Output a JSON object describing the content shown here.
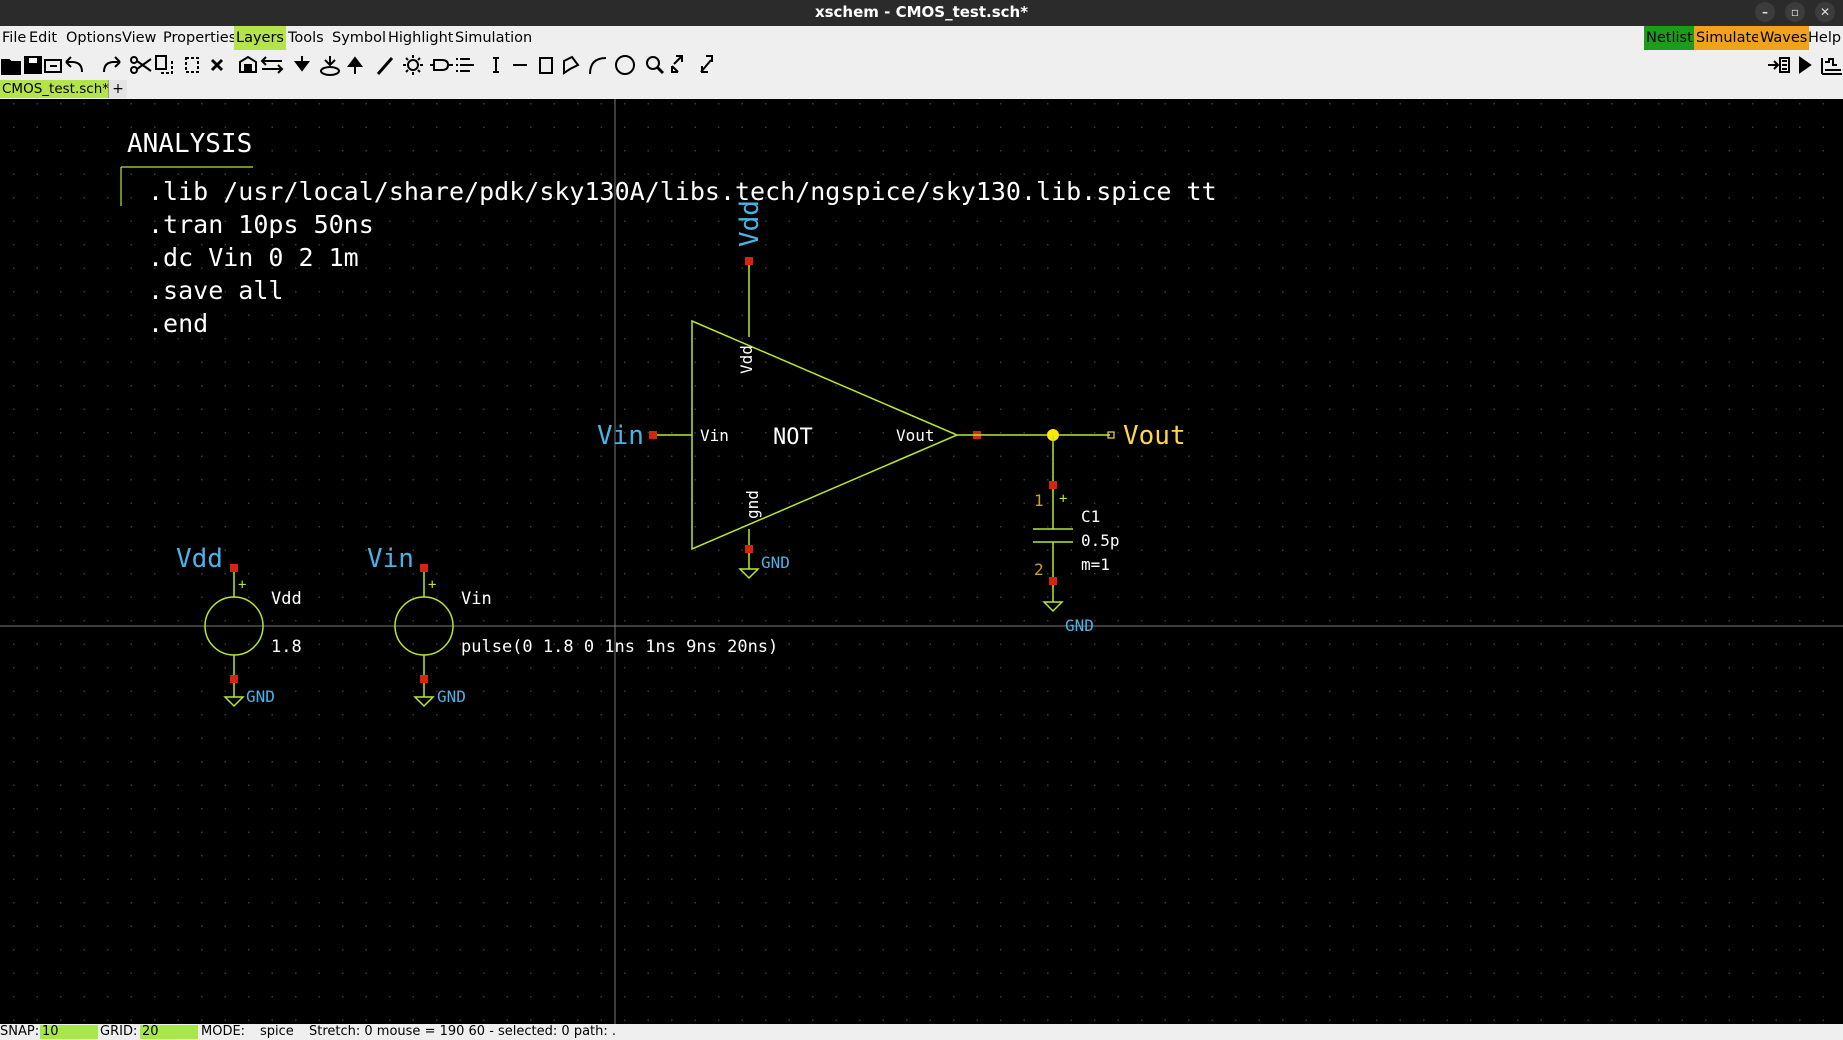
{
  "window": {
    "title": "xschem - CMOS_test.sch*",
    "buttons": [
      "–",
      "▫",
      "✕"
    ]
  },
  "menu": {
    "file": "File",
    "edit": "Edit",
    "options": "Options",
    "view": "View",
    "properties": "Properties",
    "layers": "Layers",
    "tools": "Tools",
    "symbol": "Symbol",
    "highlight": "Highlight",
    "simulation": "Simulation",
    "netlist": "Netlist",
    "simulate": "Simulate",
    "waves": "Waves",
    "help": "Help"
  },
  "tabs": {
    "active": "CMOS_test.sch*",
    "add": "+"
  },
  "toolbar_icons": [
    "open-icon",
    "save-icon",
    "reload-icon",
    "undo-icon",
    "redo-icon",
    "cut-icon",
    "copy-icon",
    "duplicate-icon",
    "delete-icon",
    "place-symbol-icon",
    "swap-icon",
    "push-down-icon",
    "descend-icon",
    "pop-up-icon",
    "wire-icon",
    "highlight-icon",
    "net-label-icon",
    "pin-icon",
    "text-icon",
    "line-icon",
    "rect-icon",
    "polygon-icon",
    "arc-icon",
    "circle-icon",
    "zoom-icon",
    "zoom-in-icon",
    "zoom-full-icon",
    "netlist-icon",
    "simulate-icon",
    "waves-icon"
  ],
  "schematic": {
    "analysis": {
      "title": "ANALYSIS",
      "lines": [
        ".lib /usr/local/share/pdk/sky130A/libs.tech/ngspice/sky130.lib.spice tt",
        ".tran 10ps 50ns",
        ".dc Vin 0 2 1m",
        ".save all",
        ".end"
      ]
    },
    "inverter": {
      "name": "NOT",
      "pin_vin": "Vin",
      "pin_vout": "Vout",
      "pin_vdd": "Vdd",
      "pin_gnd": "gnd",
      "label_in": "Vin",
      "label_vdd": "Vdd",
      "label_gnd": "GND"
    },
    "output": {
      "label": "Vout"
    },
    "capacitor": {
      "name": "C1",
      "value": "0.5p",
      "mult": "m=1",
      "pin1": "1",
      "pin2": "2",
      "gnd": "GND"
    },
    "vdd_source": {
      "label": "Vdd",
      "name": "Vdd",
      "value": "1.8",
      "gnd": "GND"
    },
    "vin_source": {
      "label": "Vin",
      "name": "Vin",
      "value": "pulse(0 1.8 0 1ns 1ns 9ns 20ns)",
      "gnd": "GND"
    },
    "colors": {
      "wire": "#b6e82c",
      "label": "#4ab3e6",
      "pin": "#d4250f",
      "node": "#ffe900",
      "output": "#ffd54a",
      "text": "#ffffff"
    }
  },
  "status": {
    "snap_label": "SNAP:",
    "snap": "10",
    "grid_label": "GRID:",
    "grid": "20",
    "mode_label": "MODE:",
    "mode": "spice",
    "info": "Stretch: 0  mouse = 190 60 - selected: 0 path: ."
  }
}
